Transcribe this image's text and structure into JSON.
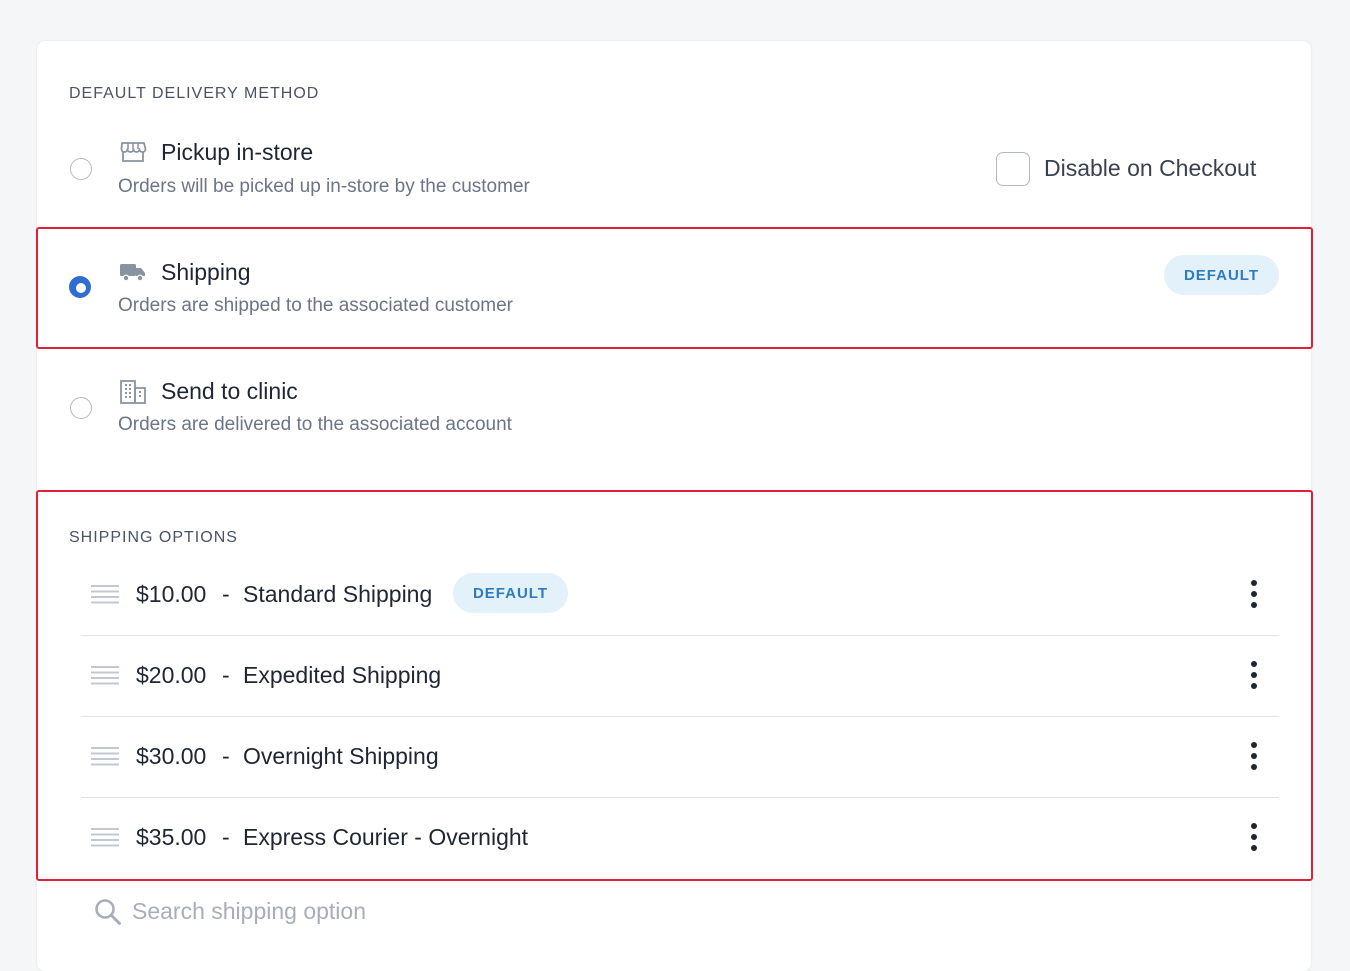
{
  "delivery": {
    "section_label": "DEFAULT DELIVERY METHOD",
    "methods": [
      {
        "title": "Pickup in-store",
        "description": "Orders will be picked up in-store by the customer",
        "icon": "store-icon",
        "selected": false
      },
      {
        "title": "Shipping",
        "description": "Orders are shipped to the associated customer",
        "icon": "truck-icon",
        "selected": true,
        "badge": "DEFAULT"
      },
      {
        "title": "Send to clinic",
        "description": "Orders are delivered to the associated account",
        "icon": "building-icon",
        "selected": false
      }
    ],
    "disable_checkbox": {
      "label": "Disable on Checkout",
      "checked": false
    }
  },
  "shipping": {
    "section_label": "SHIPPING OPTIONS",
    "options": [
      {
        "price": "$10.00",
        "separator": "-",
        "name": "Standard Shipping",
        "badge": "DEFAULT"
      },
      {
        "price": "$20.00",
        "separator": "-",
        "name": "Expedited Shipping"
      },
      {
        "price": "$30.00",
        "separator": "-",
        "name": "Overnight Shipping"
      },
      {
        "price": "$35.00",
        "separator": "-",
        "name": "Express Courier - Overnight"
      }
    ],
    "search": {
      "placeholder": "Search shipping option",
      "value": ""
    }
  },
  "colors": {
    "accent": "#2f6dd0",
    "badge_bg": "#e3f1fb",
    "badge_text": "#2f7bc0",
    "highlight": "#e0203a"
  }
}
